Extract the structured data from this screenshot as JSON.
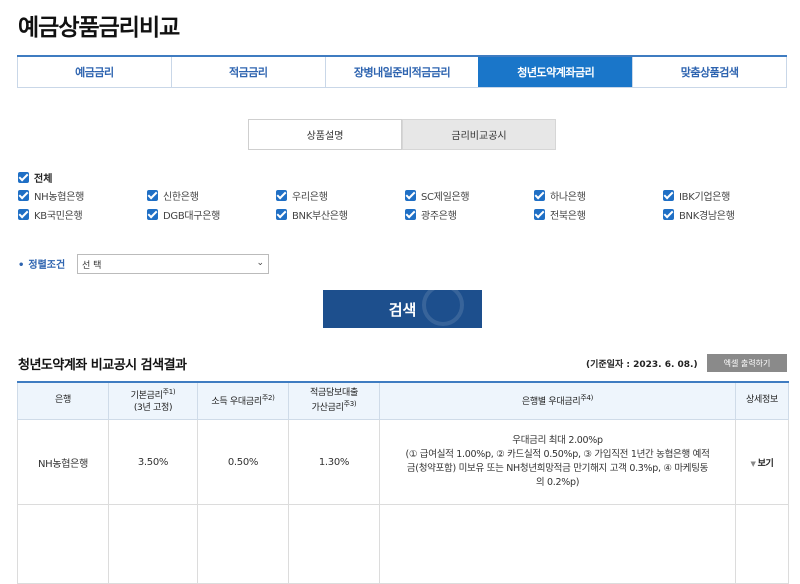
{
  "page_title": "예금상품금리비교",
  "tabs": [
    {
      "label": "예금금리",
      "active": false
    },
    {
      "label": "적금금리",
      "active": false
    },
    {
      "label": "장병내일준비적금금리",
      "active": false
    },
    {
      "label": "청년도약계좌금리",
      "active": true
    },
    {
      "label": "맞춤상품검색",
      "active": false
    }
  ],
  "subtabs": [
    {
      "label": "상품설명",
      "active": false
    },
    {
      "label": "금리비교공시",
      "active": true
    }
  ],
  "filters": {
    "all_label": "전체",
    "banks": [
      "NH농협은행",
      "신한은행",
      "우리은행",
      "SC제일은행",
      "하나은행",
      "IBK기업은행",
      "KB국민은행",
      "DGB대구은행",
      "BNK부산은행",
      "광주은행",
      "전북은행",
      "BNK경남은행"
    ]
  },
  "condition": {
    "label": "정렬조건",
    "selected": "선 택"
  },
  "search_button": "검색",
  "results": {
    "title": "청년도약계좌 비교공시 검색결과",
    "std_date": "(기준일자 : 2023. 6. 08.)",
    "excel_button": "엑셀 출력하기",
    "headers": {
      "bank": "은행",
      "base_rate_l1": "기본금리",
      "base_rate_sup": "주1)",
      "base_rate_l2": "(3년 고정)",
      "income_pref": "소득 우대금리",
      "income_pref_sup": "주2)",
      "collateral_l1": "적금담보대출",
      "collateral_l2": "가산금리",
      "collateral_sup": "주3)",
      "bank_pref": "은행별 우대금리",
      "bank_pref_sup": "주4)",
      "detail": "상세정보"
    },
    "rows": [
      {
        "bank": "NH농협은행",
        "base_rate": "3.50%",
        "income_pref": "0.50%",
        "collateral": "1.30%",
        "pref_l1": "우대금리 최대 2.00%p",
        "pref_l2": "(① 급여실적 1.00%p, ② 카드실적 0.50%p, ③ 가입직전 1년간 농협은행 예적",
        "pref_l3": "금(청약포함) 미보유 또는 NH청년희망적금 만기해지 고객 0.3%p, ④ 마케팅동",
        "pref_l4": "의 0.2%p)",
        "view": "보기"
      }
    ]
  }
}
